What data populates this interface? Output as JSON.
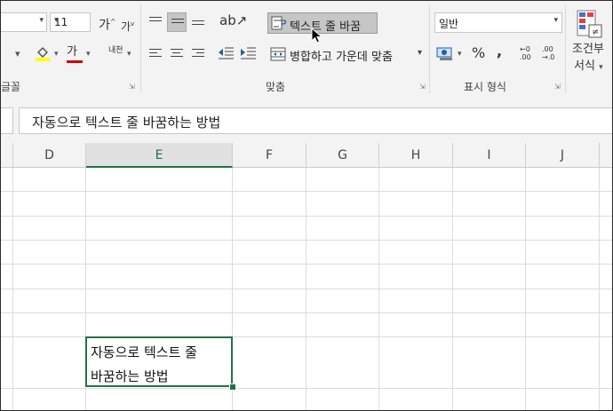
{
  "ribbon": {
    "font_size": "11",
    "font_group_label": "글꼴",
    "grow_font_glyph": "가",
    "shrink_font_glyph": "가",
    "font_color_glyph": "가",
    "phonetic_glyph": "내천",
    "alignment_group_label": "맞춤",
    "wrap_text_label": "텍스트 줄 바꿈",
    "merge_center_label": "병합하고 가운데 맞춤",
    "number_group_label": "표시 형식",
    "number_format": "일반",
    "percent_glyph": "%",
    "comma_glyph": ",",
    "increase_decimal": "←0\n.00",
    "conditional_format_label_1": "조건부",
    "conditional_format_label_2": "서식"
  },
  "formula_bar": {
    "content": "자동으로 텍스트 줄 바꿈하는 방법"
  },
  "columns": [
    "D",
    "E",
    "F",
    "G",
    "H",
    "I",
    "J"
  ],
  "active_column": "E",
  "selected_cell": {
    "line1": "자동으로 텍스트 줄",
    "line2": "바꿈하는 방법"
  },
  "colors": {
    "accent": "#217346",
    "font_color_bar": "#d00000",
    "fill_color_bar": "#ffff00"
  }
}
